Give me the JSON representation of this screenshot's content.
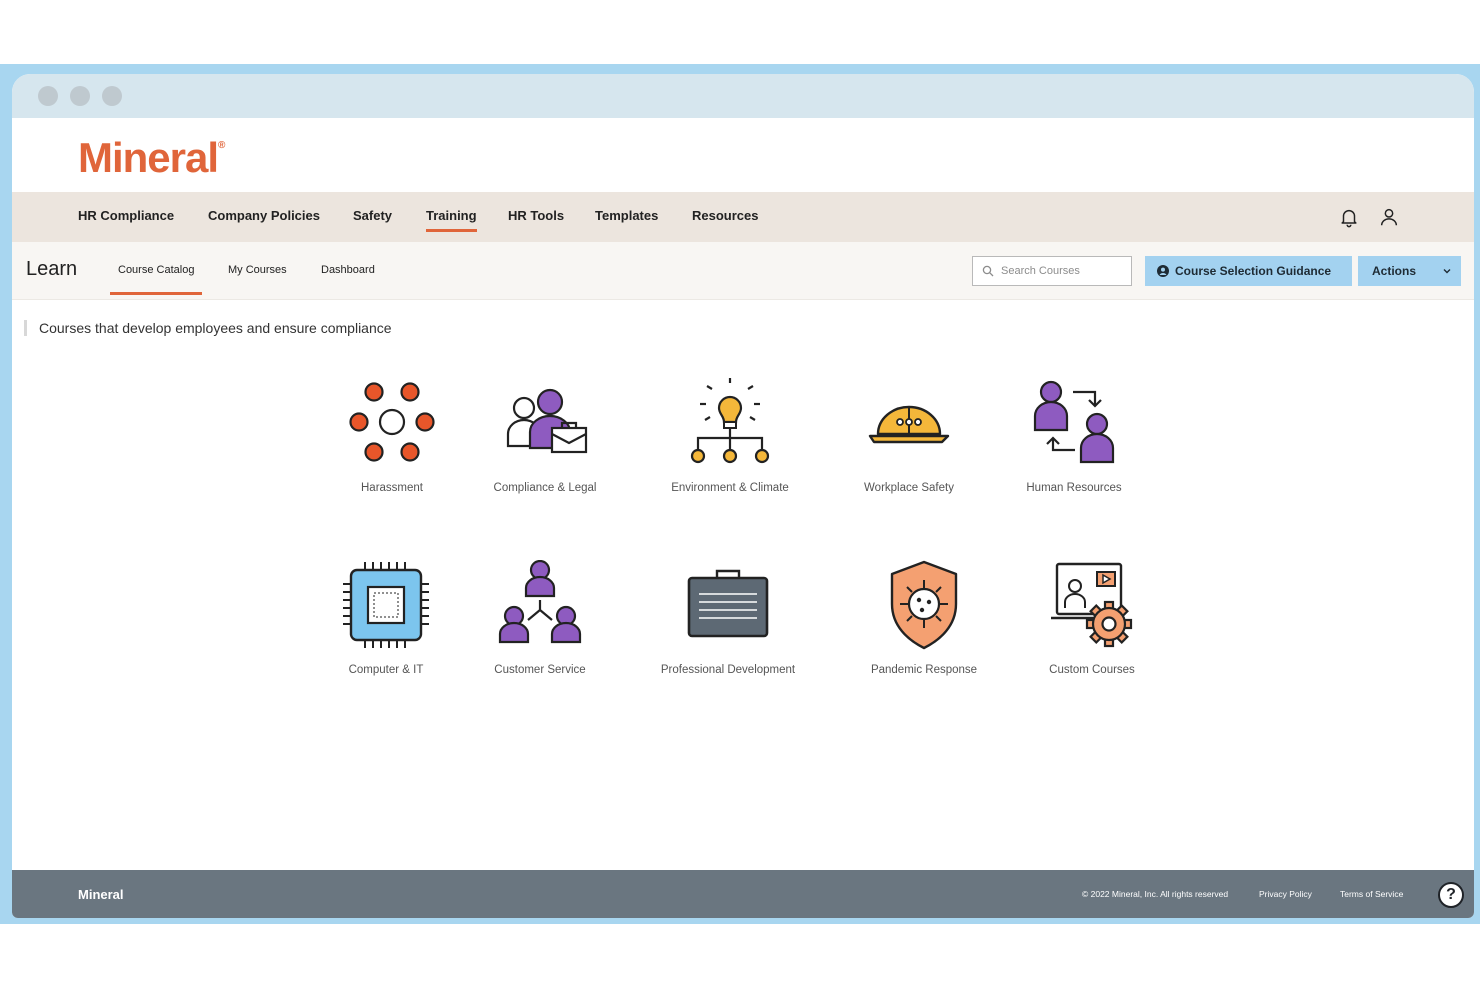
{
  "brand": {
    "logo": "Mineral",
    "mark": "®"
  },
  "main_nav": {
    "items": [
      {
        "label": "HR Compliance"
      },
      {
        "label": "Company Policies"
      },
      {
        "label": "Safety"
      },
      {
        "label": "Training",
        "active": true
      },
      {
        "label": "HR Tools"
      },
      {
        "label": "Templates"
      },
      {
        "label": "Resources"
      }
    ],
    "icons": [
      "bell-icon",
      "user-icon"
    ]
  },
  "sub_nav": {
    "title": "Learn",
    "tabs": [
      {
        "label": "Course Catalog",
        "active": true
      },
      {
        "label": "My Courses"
      },
      {
        "label": "Dashboard"
      }
    ],
    "search": {
      "placeholder": "Search Courses",
      "value": ""
    },
    "guidance_button": "Course Selection Guidance",
    "actions_button": "Actions"
  },
  "content": {
    "tagline": "Courses that develop employees and ensure compliance",
    "categories": [
      {
        "label": "Harassment",
        "icon": "harassment-icon"
      },
      {
        "label": "Compliance & Legal",
        "icon": "compliance-legal-icon"
      },
      {
        "label": "Environment & Climate",
        "icon": "lightbulb-network-icon"
      },
      {
        "label": "Workplace Safety",
        "icon": "hard-hat-icon"
      },
      {
        "label": "Human Resources",
        "icon": "people-exchange-icon"
      },
      {
        "label": "Computer & IT",
        "icon": "chip-icon"
      },
      {
        "label": "Customer Service",
        "icon": "people-network-icon"
      },
      {
        "label": "Professional Development",
        "icon": "briefcase-icon"
      },
      {
        "label": "Pandemic Response",
        "icon": "virus-shield-icon"
      },
      {
        "label": "Custom Courses",
        "icon": "screen-gear-icon"
      }
    ]
  },
  "footer": {
    "logo": "Mineral",
    "copyright": "© 2022 Mineral, Inc. All rights reserved",
    "privacy": "Privacy Policy",
    "terms": "Terms of Service",
    "help": "?"
  },
  "colors": {
    "accent": "#e0653a",
    "button": "#a3d2f0",
    "nav_bg": "#ece5de",
    "footer_bg": "#6a7680",
    "purple": "#8e5bc0",
    "yellow": "#f4b73a"
  }
}
